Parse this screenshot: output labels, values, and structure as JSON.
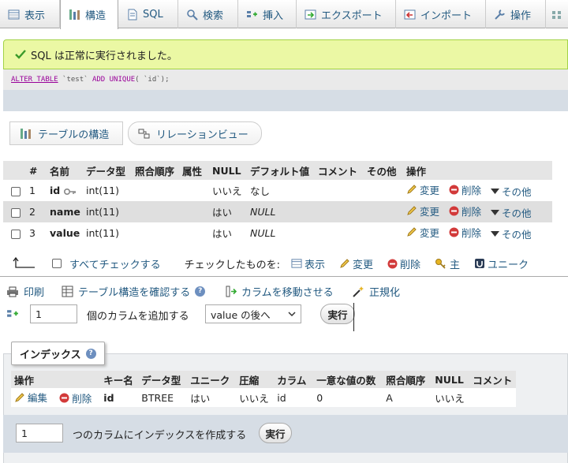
{
  "tabs": [
    {
      "label": "表示",
      "icon": "browse-icon"
    },
    {
      "label": "構造",
      "icon": "structure-icon"
    },
    {
      "label": "SQL",
      "icon": "sql-icon"
    },
    {
      "label": "検索",
      "icon": "search-icon"
    },
    {
      "label": "挿入",
      "icon": "insert-icon"
    },
    {
      "label": "エクスポート",
      "icon": "export-icon"
    },
    {
      "label": "インポート",
      "icon": "import-icon"
    },
    {
      "label": "操作",
      "icon": "wrench-icon"
    },
    {
      "label": "",
      "icon": "more-icon"
    }
  ],
  "message": {
    "success": "SQL は正常に実行されました。",
    "sql": {
      "kw1": "ALTER TABLE",
      "tbl": " `test` ",
      "kw2": "ADD UNIQUE",
      "rest": "( `id`);"
    }
  },
  "subnav": {
    "structure": "テーブルの構造",
    "relation": "リレーションビュー"
  },
  "structure": {
    "headers": [
      "#",
      "名前",
      "データ型",
      "照合順序",
      "属性",
      "NULL",
      "デフォルト値",
      "コメント",
      "その他",
      "操作"
    ],
    "rows": [
      {
        "num": "1",
        "name": "id",
        "type": "int(11)",
        "null": "いいえ",
        "default": "なし",
        "default_is_null": false
      },
      {
        "num": "2",
        "name": "name",
        "type": "int(11)",
        "null": "はい",
        "default": "NULL",
        "default_is_null": true
      },
      {
        "num": "3",
        "name": "value",
        "type": "int(11)",
        "null": "はい",
        "default": "NULL",
        "default_is_null": true
      }
    ],
    "actions": {
      "change": "変更",
      "drop": "削除",
      "more": "その他"
    }
  },
  "with_selected": {
    "check_all": "すべてチェックする",
    "label": "チェックしたものを:",
    "browse": "表示",
    "change": "変更",
    "drop": "削除",
    "primary": "主",
    "unique": "ユニーク"
  },
  "tools": {
    "print": "印刷",
    "propose": "テーブル構造を確認する",
    "move": "カラムを移動させる",
    "normalize": "正規化"
  },
  "add_columns": {
    "count": "1",
    "label": "個のカラムを追加する",
    "position": "value の後へ",
    "go": "実行"
  },
  "indexes": {
    "title": "インデックス",
    "headers": [
      "操作",
      "キー名",
      "データ型",
      "ユニーク",
      "圧縮",
      "カラム",
      "一意な値の数",
      "照合順序",
      "NULL",
      "コメント"
    ],
    "rows": [
      {
        "edit": "編集",
        "drop": "削除",
        "keyname": "id",
        "type": "BTREE",
        "unique": "はい",
        "packed": "いいえ",
        "column": "id",
        "cardinality": "0",
        "collation": "A",
        "null": "いいえ",
        "comment": ""
      }
    ],
    "create_count": "1",
    "create_label": "つのカラムにインデックスを作成する",
    "go": "実行"
  },
  "colors": {
    "link": "#235a81",
    "success_bg": "#ebf8a4",
    "success_border": "#a2d246",
    "drop_red": "#d23a3a"
  }
}
